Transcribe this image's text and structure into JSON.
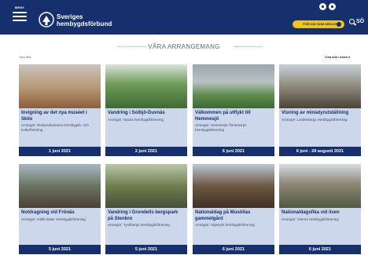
{
  "header": {
    "menu_label": "MENY",
    "brand_line1": "Sveriges",
    "brand_line2": "hembygdsförbund",
    "member_button": "FÖR DIG SOM MEDLEM",
    "search_label": "SÖ"
  },
  "section": {
    "title": "VÅRA ARRANGEMANG",
    "show_all": "Visa alla",
    "map_link": "Visa alla i karta"
  },
  "events": [
    {
      "title": "Invigning av det nya muséet i Skilo",
      "organizer": "Arrangör: Rekarnebyhama Hembygds- och kulturförening",
      "date": "1 juni 2021"
    },
    {
      "title": "Vandring i Solbjö-Duvnäs",
      "organizer": "Arrangör: Nacka hembygdsförening",
      "date": "2 juni 2021"
    },
    {
      "title": "Välkommen på utflykt till Hemmesjö",
      "organizer": "Arrangör: Hemmesjö-Ålmestorps hembygdsförening",
      "date": "6 juni 2021"
    },
    {
      "title": "Visning av miniatyrutställning",
      "organizer": "Arrangör: Lindesbergs Hembygdsförening",
      "date": "6 juni - 28 augusti 2021"
    },
    {
      "title": "Notdragning vid Frönäs",
      "organizer": "Arrangör: Gällö-Säter Hembygdsförening",
      "date": "5 juni 2021"
    },
    {
      "title": "Vandring i Grondells bergspark på Stenbro",
      "organizer": "Arrangör: Tyskbergs hembygdsförening",
      "date": "5 juni 2021"
    },
    {
      "title": "Nationaldag på Musöllas gammelgård",
      "organizer": "Arrangör: Sigeryds hembygdsförening",
      "date": "6 juni 2021"
    },
    {
      "title": "Nationaldagsfika vid ilven",
      "organizer": "Arrangör: Yverus Hembygdsförening",
      "date": "6 juni 2021"
    }
  ]
}
